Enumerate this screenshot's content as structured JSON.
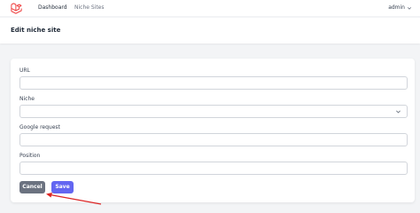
{
  "navbar": {
    "logo_icon": "laravel-logo-icon",
    "links": [
      {
        "label": "Dashboard"
      },
      {
        "label": "Niche Sites"
      }
    ],
    "user": {
      "label": "admin",
      "icon": "chevron-down-icon"
    }
  },
  "header": {
    "title": "Edit niche site"
  },
  "form": {
    "url": {
      "label": "URL",
      "value": ""
    },
    "niche": {
      "label": "Niche",
      "value": ""
    },
    "google_request": {
      "label": "Google request",
      "value": ""
    },
    "position": {
      "label": "Position",
      "value": ""
    }
  },
  "actions": {
    "cancel_label": "Cancel",
    "save_label": "Save"
  },
  "colors": {
    "primary": "#6366f1",
    "secondary": "#6b7280",
    "annotation": "#dc2626"
  }
}
